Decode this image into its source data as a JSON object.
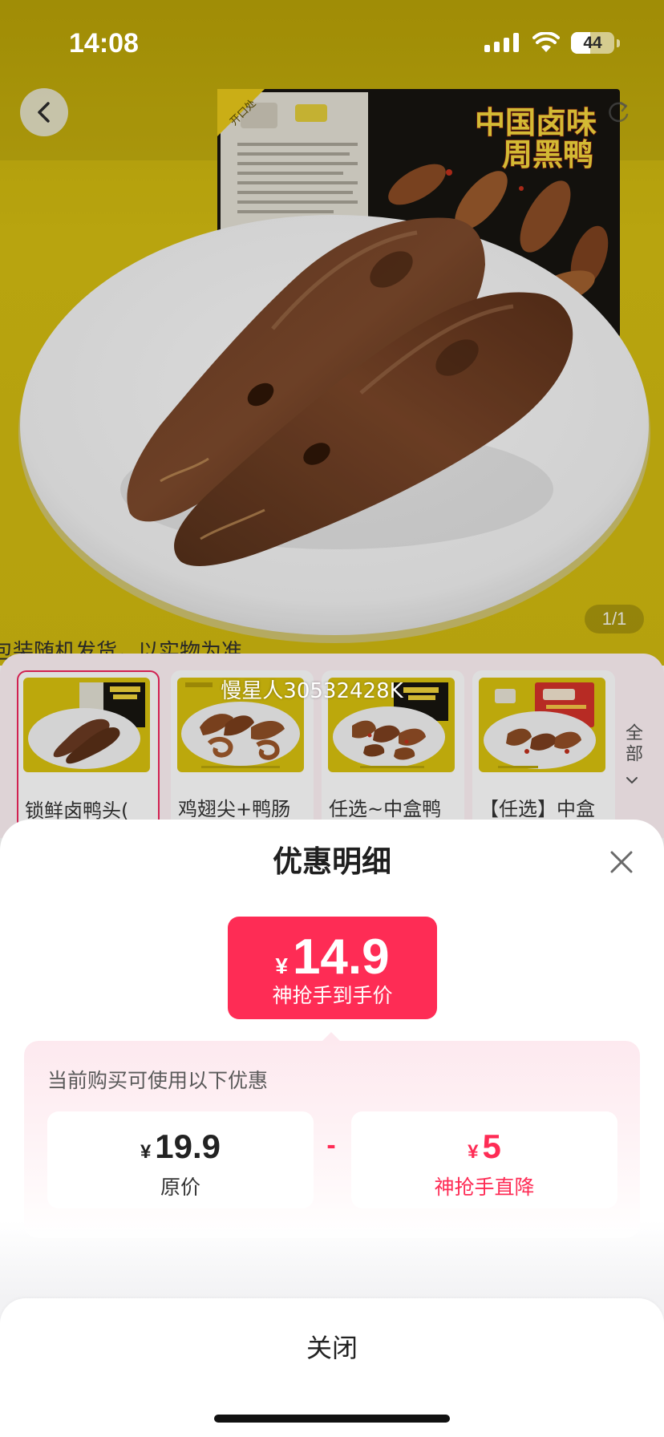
{
  "status_bar": {
    "time": "14:08",
    "battery": "44"
  },
  "product": {
    "package_title_line1": "中国卤味",
    "package_title_line2": "周黑鸭",
    "package_tag": "开口处",
    "image_counter": "1/1",
    "notice": "包装随机发货，以实物为准"
  },
  "watermark": "慢星人30532428K",
  "variants": {
    "items": [
      {
        "label": "锁鲜卤鸭头(",
        "selected": true
      },
      {
        "label": "鸡翅尖+鸭肠",
        "selected": false
      },
      {
        "label": "任选~中盒鸭",
        "selected": false
      },
      {
        "label": "【任选】中盒",
        "selected": false
      }
    ],
    "all_label": "全部"
  },
  "sheet": {
    "title": "优惠明细",
    "final_price": {
      "currency": "¥",
      "amount": "14.9",
      "caption": "神抢手到手价"
    },
    "discount_intro": "当前购买可使用以下优惠",
    "original": {
      "currency": "¥",
      "amount": "19.9",
      "caption": "原价"
    },
    "operator": "-",
    "discount": {
      "currency": "¥",
      "amount": "5",
      "caption": "神抢手直降"
    },
    "close_button": "关闭"
  },
  "icons": {
    "back": "chevron-left-icon",
    "share": "share-icon",
    "close": "close-icon",
    "expand": "chevron-down-icon"
  },
  "colors": {
    "accent": "#fe2c55",
    "product_background": "#d6bf12",
    "selected_border": "#f0275e"
  }
}
